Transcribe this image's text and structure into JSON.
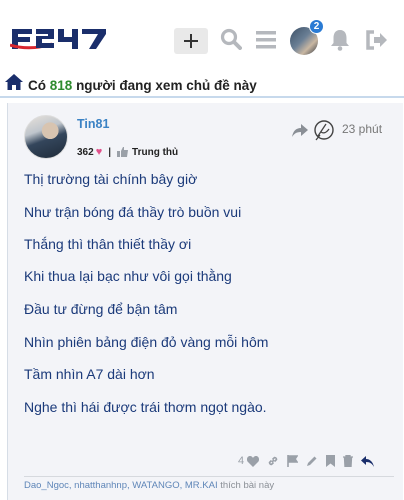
{
  "header": {
    "logo_text": "F247",
    "notifications_count": "2",
    "colors": {
      "brand_blue": "#1a2e6b",
      "brand_red": "#d8262f",
      "icon_gray": "#b5b8bd"
    }
  },
  "viewers": {
    "prefix": "Có",
    "count": "818",
    "suffix": "người đang xem chủ đề này"
  },
  "post": {
    "username": "Tin81",
    "likes_received": "362",
    "rank": "Trung thủ",
    "time": "23 phút",
    "lines": [
      "Thị trường tài chính bây giờ",
      "Như trận bóng đá thầy trò buồn vui",
      "Thắng thì thân thiết thầy ơi",
      "Khi thua lại bạc như vôi gọi thằng",
      "Đầu tư đừng để bận tâm",
      "Nhìn phiên bảng điện đỏ vàng mỗi hôm",
      "Tầm nhìn A7 dài hơn",
      "Nghe thì hái được trái thơm ngọt ngào."
    ],
    "like_count": "4",
    "liked_by": "Dao_Ngoc, nhatthanhnp, WATANGO, MR.KAI",
    "liked_suffix": "thích bài này"
  }
}
